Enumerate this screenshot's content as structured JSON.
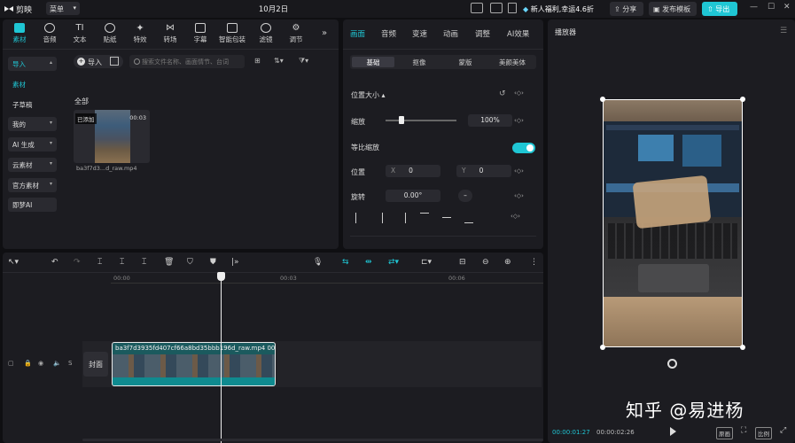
{
  "titlebar": {
    "app_name": "剪映",
    "menu_label": "菜单",
    "date": "10月2日",
    "promo_text": "新人福利,幸运4.6折",
    "share_label": "分享",
    "publish_label": "发布模板",
    "export_label": "导出"
  },
  "media": {
    "tools": [
      "素材",
      "音频",
      "文本",
      "贴纸",
      "特效",
      "转场",
      "字幕",
      "智能包装",
      "滤镜",
      "调节"
    ],
    "nav": [
      "导入",
      "素材",
      "子草稿",
      "我的",
      "AI 生成",
      "云素材",
      "官方素材",
      "即梦AI"
    ],
    "import_label": "导入",
    "search_placeholder": "搜索文件名称、画面情节、台词",
    "all_label": "全部",
    "thumb_badge": "已添加",
    "thumb_duration": "00:03",
    "thumb_name": "ba3f7d3...d_raw.mp4"
  },
  "props": {
    "tabs": [
      "画面",
      "音频",
      "变速",
      "动画",
      "调整",
      "AI效果"
    ],
    "subtabs": [
      "基础",
      "抠像",
      "蒙版",
      "美颜美体"
    ],
    "section_title": "位置大小",
    "scale_label": "缩放",
    "scale_value": "100%",
    "uniform_label": "等比缩放",
    "position_label": "位置",
    "x_label": "X",
    "x_value": "0",
    "y_label": "Y",
    "y_value": "0",
    "rotation_label": "旋转",
    "rotation_value": "0.00°"
  },
  "player": {
    "title": "播放器",
    "watermark": "知乎 @易进杨",
    "current_time": "00:00:01:27",
    "total_time": "00:00:02:26",
    "btn_original": "原画",
    "btn_ratio": "比例"
  },
  "timeline": {
    "ticks": [
      "00:00",
      "00:03",
      "00:06"
    ],
    "cover_label": "封面",
    "clip_name": "ba3f7d3935fd407cf66a8bd35bbb196d_raw.mp4",
    "clip_duration": "00"
  },
  "colors": {
    "accent": "#1fc6d4",
    "panel": "#1c1c21",
    "background": "#0f0f12"
  }
}
